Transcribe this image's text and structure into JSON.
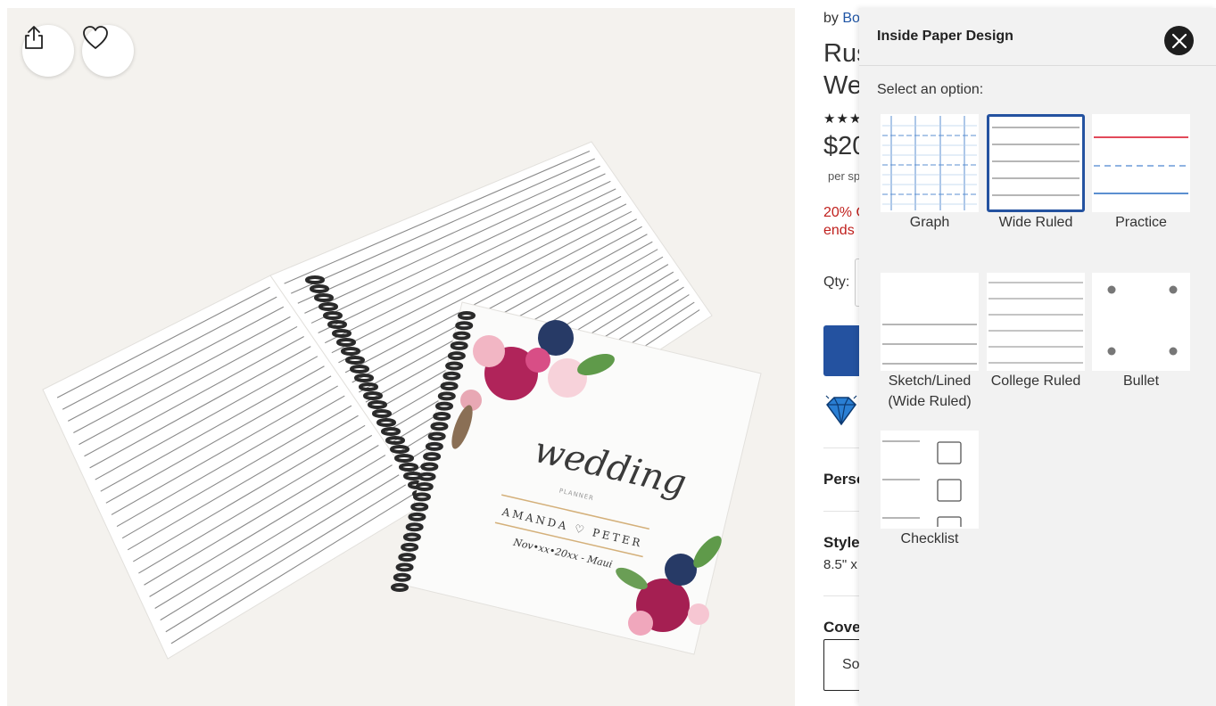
{
  "photo": {
    "share_icon": "share-icon",
    "favorite_icon": "heart-icon",
    "cover": {
      "script_word": "wedding",
      "subtitle": "PLANNER",
      "names": "AMANDA ♡ PETER",
      "date": "Nov•xx•20xx - Maui"
    }
  },
  "product": {
    "by_prefix": "by",
    "shop_partial": "Bo",
    "title_line1": "Rus",
    "title_line2": "We",
    "stars": "★★★",
    "price_partial": "$20",
    "per_sheet_partial": "per sp",
    "promo_line1": "20% C",
    "promo_line2": "ends",
    "qty_label": "Qty:",
    "personalize_partial": "Perso",
    "style_label": "Style",
    "style_value_partial": "8.5\" x",
    "cover_label_partial": "Cove",
    "cover_value_partial": "So"
  },
  "panel": {
    "title": "Inside Paper Design",
    "close_icon": "close-icon",
    "select_label": "Select an option:",
    "selected": "Wide Ruled",
    "options": [
      {
        "label": "Graph"
      },
      {
        "label": "Wide Ruled"
      },
      {
        "label": "Practice"
      },
      {
        "label": "Sketch/Lined\n(Wide Ruled)",
        "line1": "Sketch/Lined",
        "line2": "(Wide Ruled)"
      },
      {
        "label": "College Ruled"
      },
      {
        "label": "Bullet"
      },
      {
        "label": "Checklist"
      }
    ]
  },
  "colors": {
    "accent": "#2452a0",
    "promo": "#c0201d",
    "panel_bg": "#f2f2f2"
  }
}
